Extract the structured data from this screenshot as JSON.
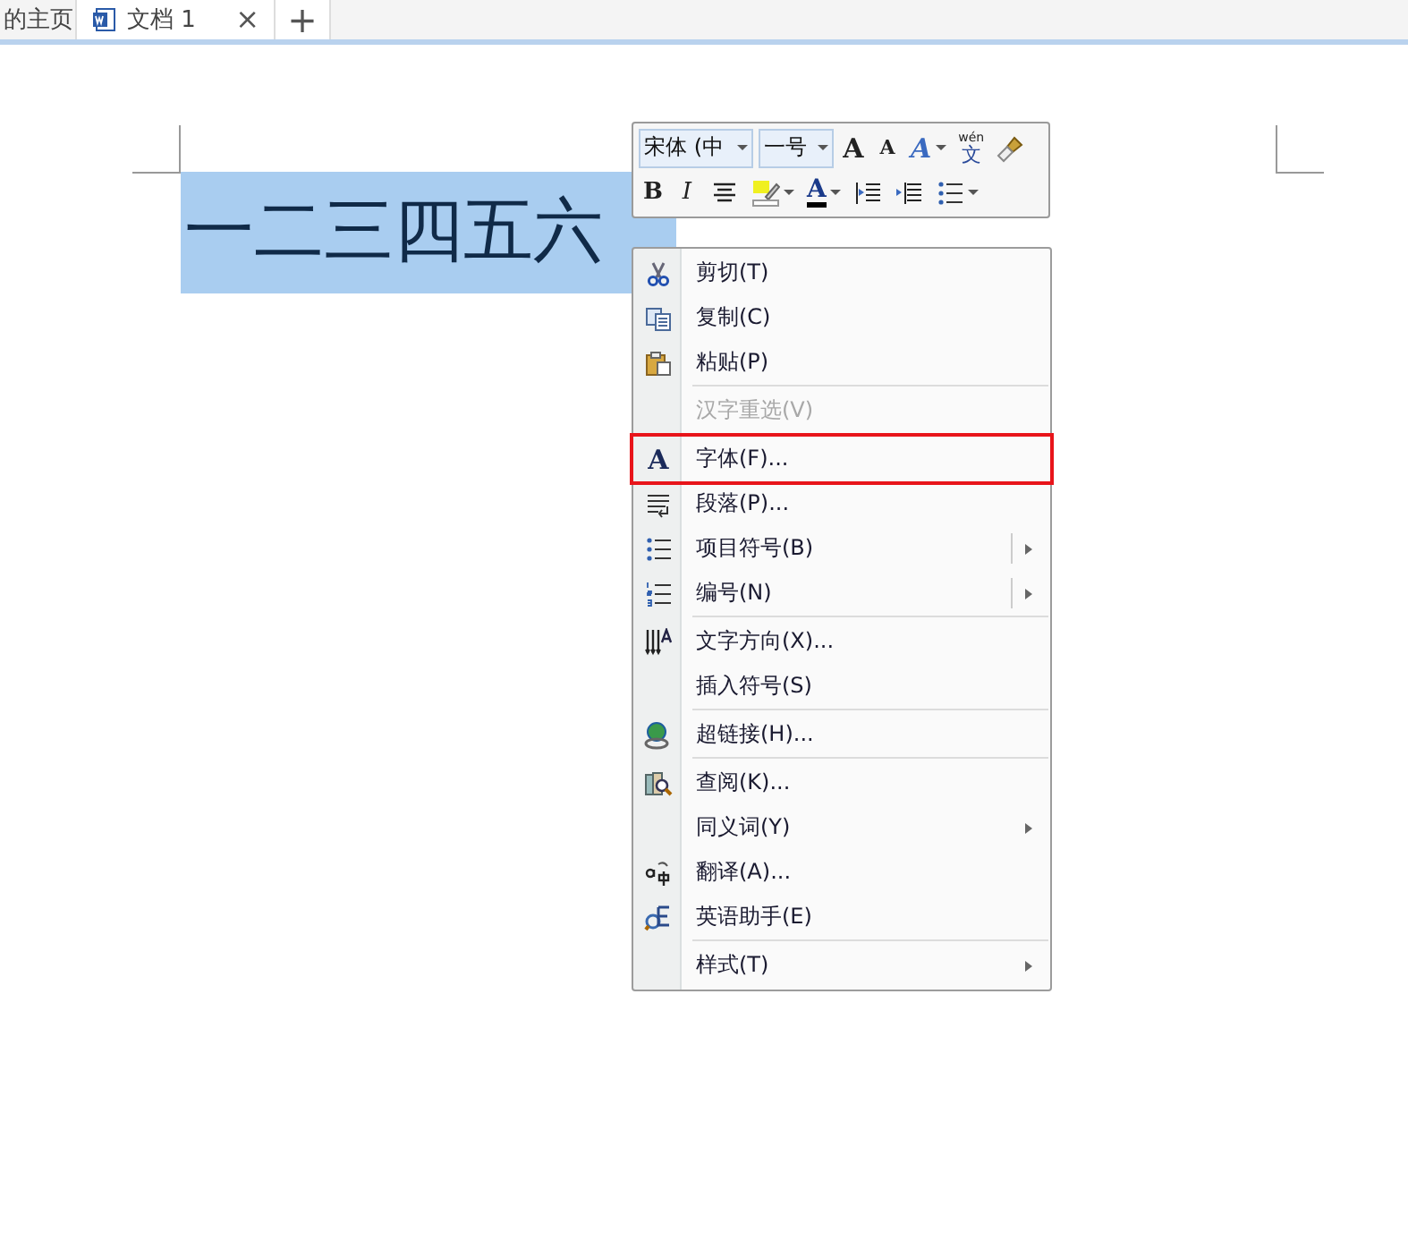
{
  "tabs": [
    {
      "label": "的主页",
      "selected": false,
      "kind": "home"
    },
    {
      "label": "文档 1",
      "selected": true,
      "kind": "document",
      "close": "×"
    }
  ],
  "new_tab": "+",
  "document": {
    "text": "一二三四五六",
    "selected": true
  },
  "mini_toolbar": {
    "font": "宋体 (中",
    "size": "一号",
    "row1": [
      {
        "kind": "grow",
        "glyph": "A"
      },
      {
        "kind": "shrink",
        "glyph": "A"
      },
      {
        "kind": "effects",
        "glyph": "A"
      },
      {
        "kind": "phonetic",
        "ruby": "wén",
        "base": "文"
      },
      {
        "kind": "brush"
      }
    ],
    "row2": [
      {
        "kind": "bold",
        "glyph": "B"
      },
      {
        "kind": "italic",
        "glyph": "I"
      },
      {
        "kind": "align"
      },
      {
        "kind": "highlight"
      },
      {
        "kind": "color",
        "glyph": "A"
      },
      {
        "kind": "outdent"
      },
      {
        "kind": "indent"
      },
      {
        "kind": "bullets"
      }
    ]
  },
  "context_menu": {
    "groups": [
      [
        {
          "label": "剪切(T)",
          "kind": "plain",
          "disabled": false,
          "highlighted": false
        },
        {
          "label": "复制(C)",
          "kind": "plain",
          "disabled": false,
          "highlighted": false
        },
        {
          "label": "粘贴(P)",
          "kind": "plain",
          "disabled": false,
          "highlighted": false
        }
      ],
      [
        {
          "label": "汉字重选(V)",
          "kind": "plain",
          "disabled": true,
          "highlighted": false
        }
      ],
      [
        {
          "label": "字体(F)...",
          "kind": "plain",
          "disabled": false,
          "highlighted": true,
          "icon_glyph": "A"
        },
        {
          "label": "段落(P)...",
          "kind": "plain",
          "disabled": false,
          "highlighted": false
        },
        {
          "label": "项目符号(B)",
          "kind": "split_submenu",
          "disabled": false,
          "highlighted": false
        },
        {
          "label": "编号(N)",
          "kind": "split_submenu",
          "disabled": false,
          "highlighted": false
        }
      ],
      [
        {
          "label": "文字方向(X)...",
          "kind": "plain",
          "disabled": false,
          "highlighted": false
        },
        {
          "label": "插入符号(S)",
          "kind": "plain",
          "disabled": false,
          "highlighted": false
        }
      ],
      [
        {
          "label": "超链接(H)...",
          "kind": "plain",
          "disabled": false,
          "highlighted": false
        }
      ],
      [
        {
          "label": "查阅(K)...",
          "kind": "plain",
          "disabled": false,
          "highlighted": false
        },
        {
          "label": "同义词(Y)",
          "kind": "submenu",
          "disabled": false,
          "highlighted": false
        },
        {
          "label": "翻译(A)...",
          "kind": "plain",
          "disabled": false,
          "highlighted": false
        },
        {
          "label": "英语助手(E)",
          "kind": "plain",
          "disabled": false,
          "highlighted": false
        }
      ],
      [
        {
          "label": "样式(T)",
          "kind": "submenu",
          "disabled": false,
          "highlighted": false
        }
      ]
    ]
  }
}
